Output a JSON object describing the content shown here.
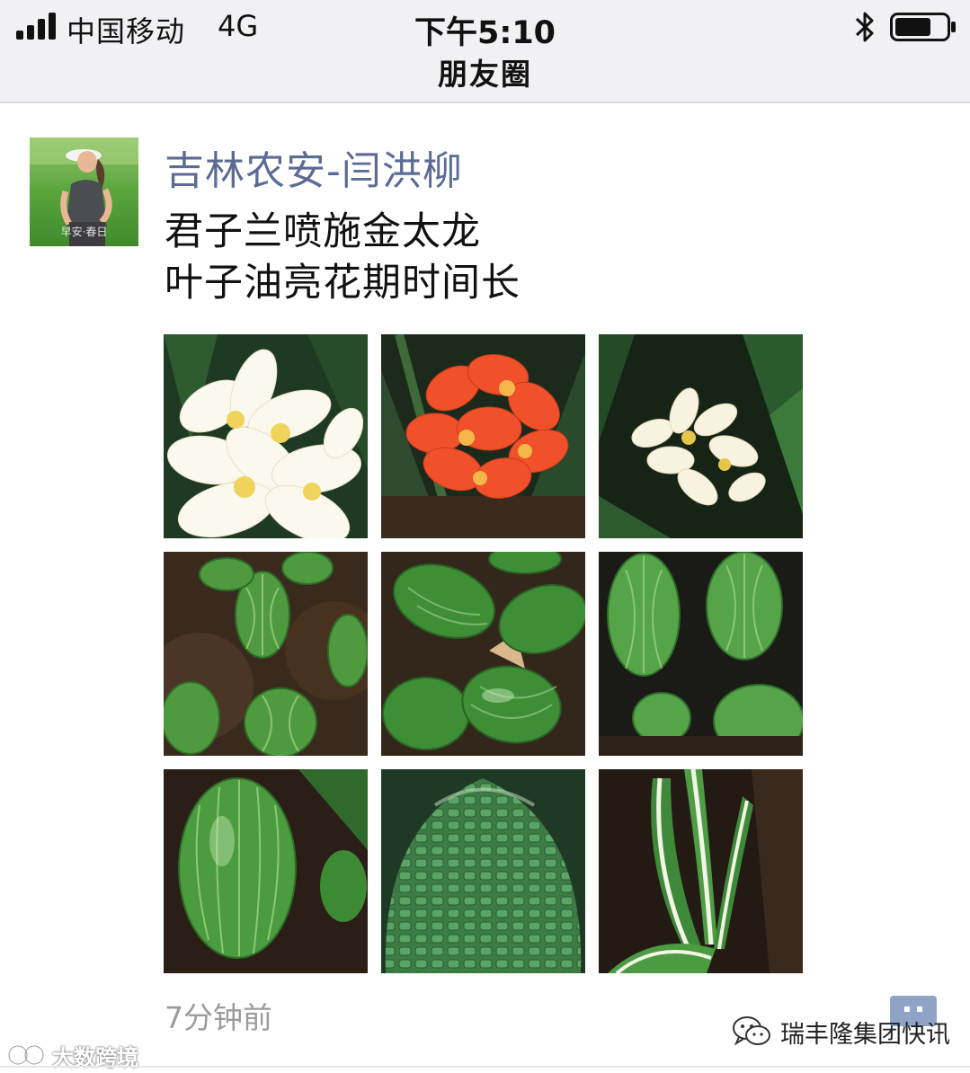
{
  "status_bar": {
    "carrier": "中国移动",
    "network": "4G",
    "time": "下午5:10",
    "signal_icon": "signal-bars-icon",
    "bluetooth_icon": "bluetooth-icon",
    "battery_icon": "battery-icon",
    "battery_level": 0.7
  },
  "nav": {
    "title": "朋友圈"
  },
  "post": {
    "author": "吉林农安-闫洪柳",
    "text_lines": [
      "君子兰喷施金太龙",
      "叶子油亮花期时间长"
    ],
    "avatar_caption": "早安·春日",
    "photos": [
      "white clivia flowers",
      "orange clivia flowers",
      "cream clivia flowers",
      "green striped clivia leaves in pots",
      "glossy green clivia leaves",
      "green clivia leaves close-up",
      "green striped leaf close-up",
      "textured green leaf close-up",
      "variegated green-white clivia leaves"
    ],
    "timestamp": "7分钟前",
    "comment_icon": "comment-icon"
  },
  "watermarks": {
    "left": "大数跨境",
    "right": "瑞丰隆集团快讯",
    "right_icon": "wechat-icon"
  },
  "colors": {
    "author": "#5b6b93",
    "topbar_bg": "#f1f1f3",
    "timestamp": "#9b9b9b"
  }
}
